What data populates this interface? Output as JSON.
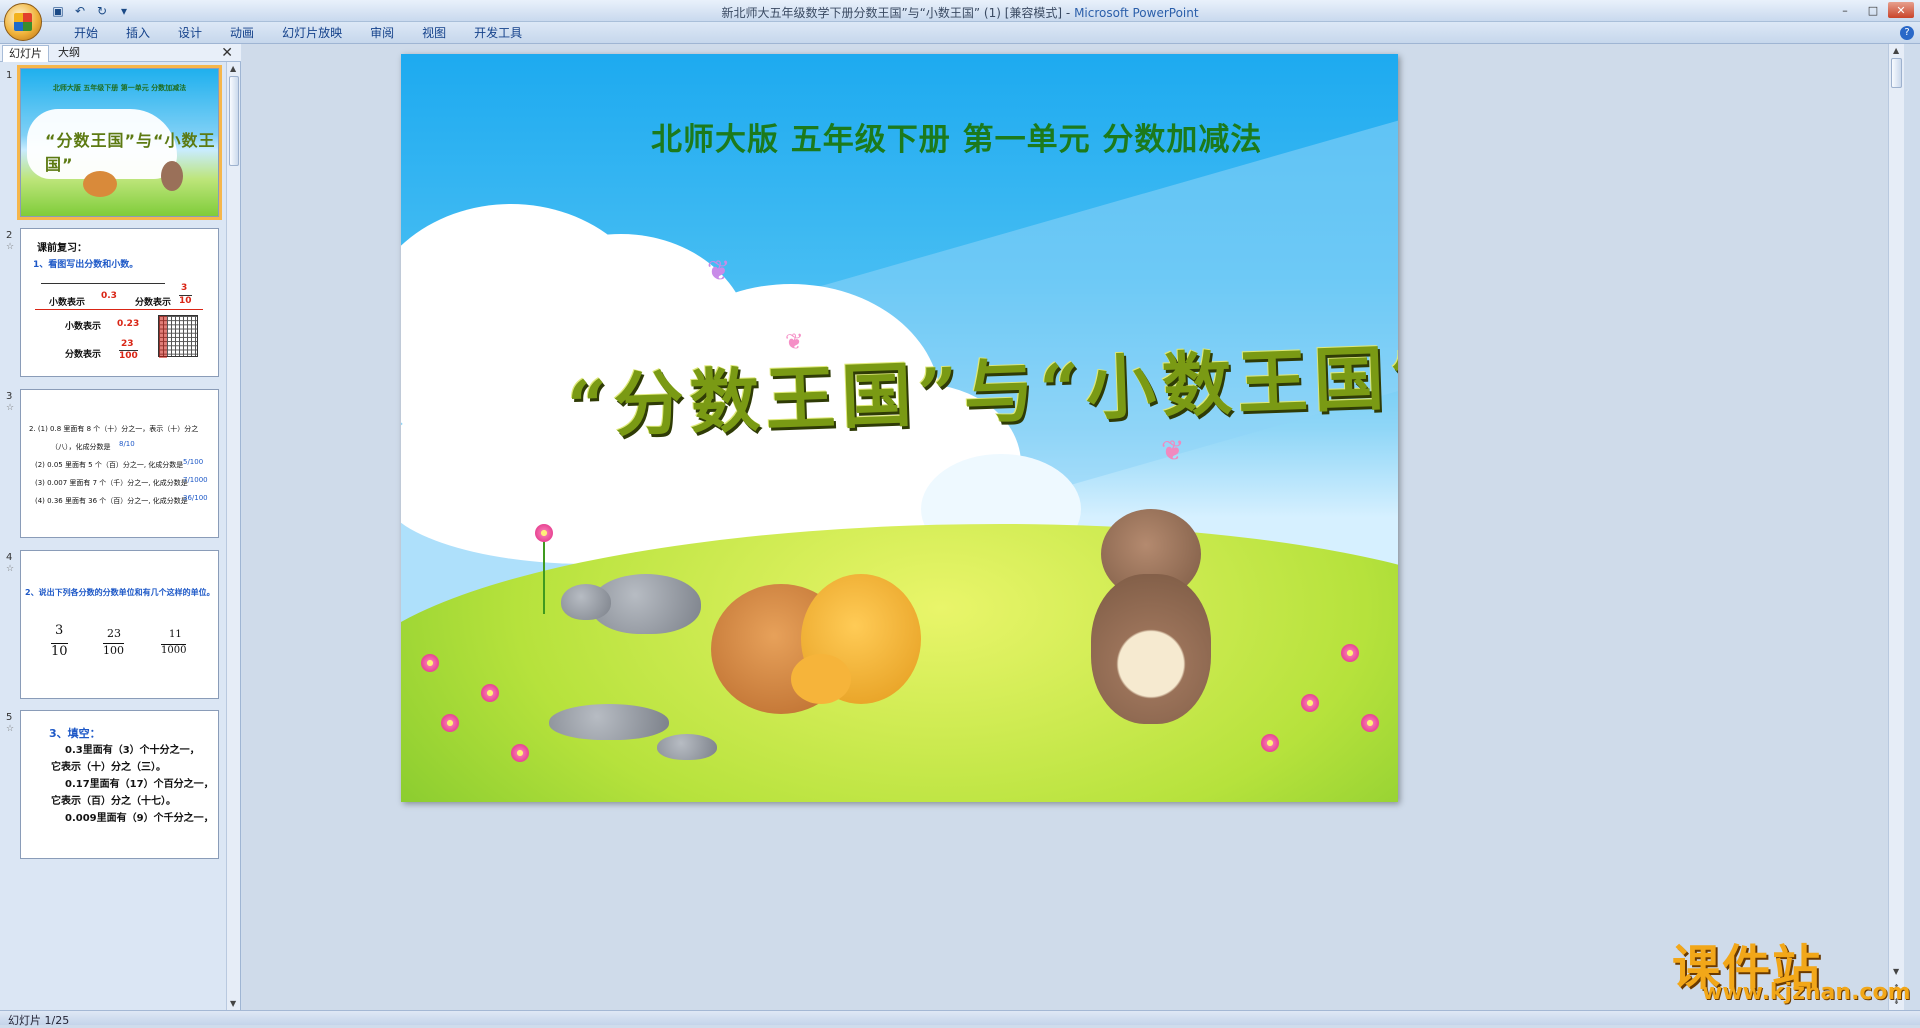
{
  "window": {
    "title": "新北师大五年级数学下册分数王国”与“小数王国” (1) [兼容模式]",
    "app_name": "Microsoft PowerPoint",
    "controls": [
      "–",
      "□",
      "✕"
    ]
  },
  "ribbon": {
    "tabs": [
      "开始",
      "插入",
      "设计",
      "动画",
      "幻灯片放映",
      "审阅",
      "视图",
      "开发工具"
    ],
    "help": "?"
  },
  "left_pane": {
    "tabs": [
      "幻灯片",
      "大纲"
    ],
    "close": "✕",
    "slides": [
      {
        "num": "1",
        "selected": true
      },
      {
        "num": "2"
      },
      {
        "num": "3"
      },
      {
        "num": "4"
      },
      {
        "num": "5"
      }
    ],
    "thumb1": {
      "subtitle": "北师大版  五年级下册  第一单元  分数加减法",
      "headline": "“分数王国”与“小数王国”"
    },
    "thumb2": {
      "heading": "课前复习：",
      "q1": "1、看图写出分数和小数。",
      "decimal_label": "小数表示",
      "decimal_value": "0.3",
      "fraction_label": "分数表示",
      "frac_num": "3",
      "frac_den": "10",
      "decimal_label2": "小数表示",
      "decimal_value2": "0.23",
      "fraction_label2": "分数表示",
      "frac_num2": "23",
      "frac_den2": "100"
    },
    "thumb3": {
      "l1": "2. (1) 0.8 里面有 8 个（十）分之一，表示（十）分之",
      "l2": "（八），化成分数是",
      "l2_frac": "8/10",
      "l3": "(2) 0.05 里面有 5 个（百）分之一, 化成分数是",
      "l3_frac": "5/100",
      "l4": "(3) 0.007 里面有 7 个（千）分之一, 化成分数是",
      "l4_frac": "7/1000",
      "l5": "(4) 0.36 里面有 36 个（百）分之一, 化成分数是",
      "l5_frac": "36/100"
    },
    "thumb4": {
      "q": "2、说出下列各分数的分数单位和有几个这样的单位。",
      "fractions": [
        {
          "num": "3",
          "den": "10"
        },
        {
          "num": "23",
          "den": "100"
        },
        {
          "num": "11",
          "den": "1000"
        }
      ]
    },
    "thumb5": {
      "heading": "3、填空：",
      "l1": "0.3里面有（3）个十分之一，",
      "l2": "它表示（十）分之（三）。",
      "l3": "0.17里面有（17）个百分之一，",
      "l4": "它表示（百）分之（十七）。",
      "l5": "0.009里面有（9）个千分之一，"
    }
  },
  "slide": {
    "subtitle": "北师大版  五年级下册  第一单元  分数加减法",
    "headline": "“分数王国”与“小数王国”"
  },
  "watermark": {
    "line1": "课件站",
    "line2": "www.kjzhan.com"
  },
  "status": {
    "text": "幻灯片 1/25"
  }
}
